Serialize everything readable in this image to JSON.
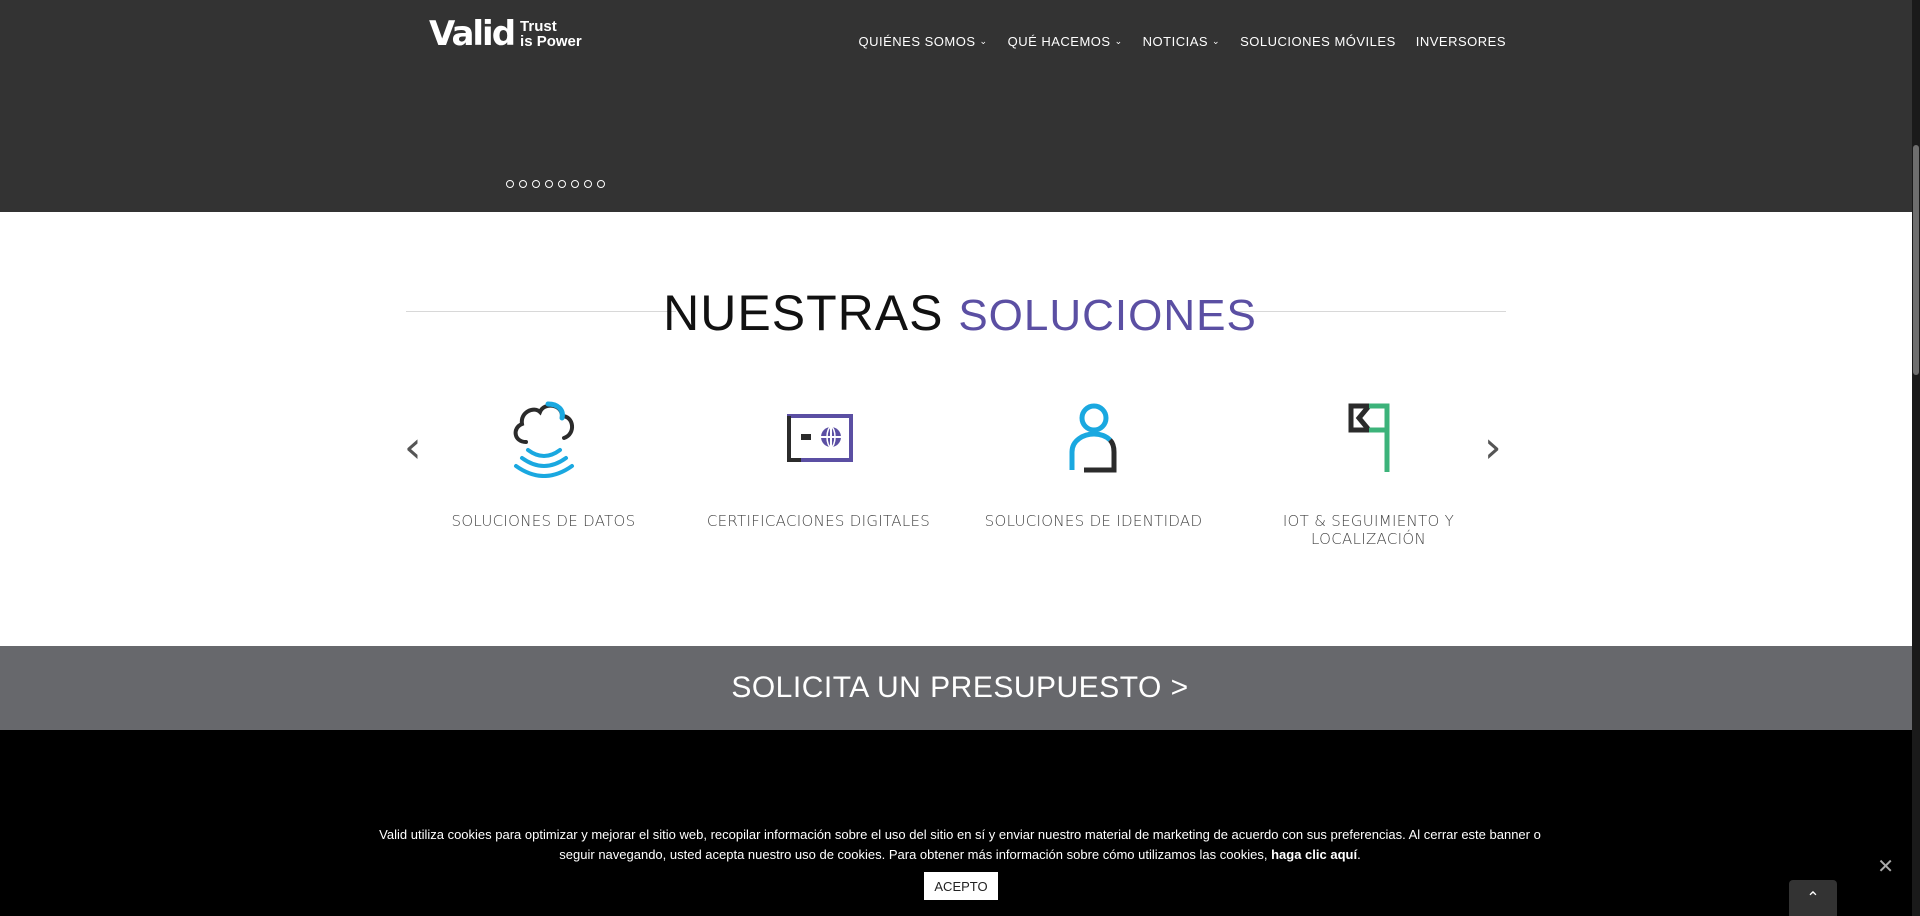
{
  "header": {
    "logo_word": "Valid",
    "logo_tag_line1": "Trust",
    "logo_tag_line2": "is Power",
    "nav": [
      {
        "label": "QUIÉNES SOMOS",
        "has_dropdown": true
      },
      {
        "label": "QUÉ HACEMOS",
        "has_dropdown": true
      },
      {
        "label": "NOTICIAS",
        "has_dropdown": true
      },
      {
        "label": "SOLUCIONES MÓVILES",
        "has_dropdown": false
      },
      {
        "label": "INVERSORES",
        "has_dropdown": false
      }
    ],
    "slider_dots": 8
  },
  "solutions": {
    "title_main": "NUESTRAS",
    "title_accent": "SOLUCIONES",
    "prev_icon": "chevron-left-icon",
    "next_icon": "chevron-right-icon",
    "items": [
      {
        "label": "SOLUCIONES DE DATOS",
        "icon": "cloud-wifi-icon"
      },
      {
        "label": "CERTIFICACIONES DIGITALES",
        "icon": "certificate-card-icon"
      },
      {
        "label": "SOLUCIONES DE IDENTIDAD",
        "icon": "person-icon"
      },
      {
        "label": "IOT & SEGUIMIENTO Y LOCALIZACIÓN",
        "icon": "flag-icon"
      }
    ]
  },
  "cta": {
    "label": "SOLICITA UN PRESUPUESTO >"
  },
  "cookie": {
    "text": "Valid utiliza cookies para optimizar y mejorar el sitio web, recopilar información sobre el uso del sitio en sí y enviar nuestro material de marketing de acuerdo con sus preferencias. Al cerrar este banner o seguir navegando, usted acepta nuestro uso de cookies. Para obtener más información sobre cómo utilizamos las cookies,",
    "link": "haga clic aquí",
    "after": ".",
    "accept_label": "ACEPTO",
    "close_icon": "close-icon",
    "to_top_icon": "chevron-up-icon"
  },
  "colors": {
    "hero_bg": "#333333",
    "accent_purple": "#5b4fa3",
    "icon_blue": "#1aa8e0",
    "icon_green": "#3cb37a",
    "cta_bg": "#67686c"
  }
}
